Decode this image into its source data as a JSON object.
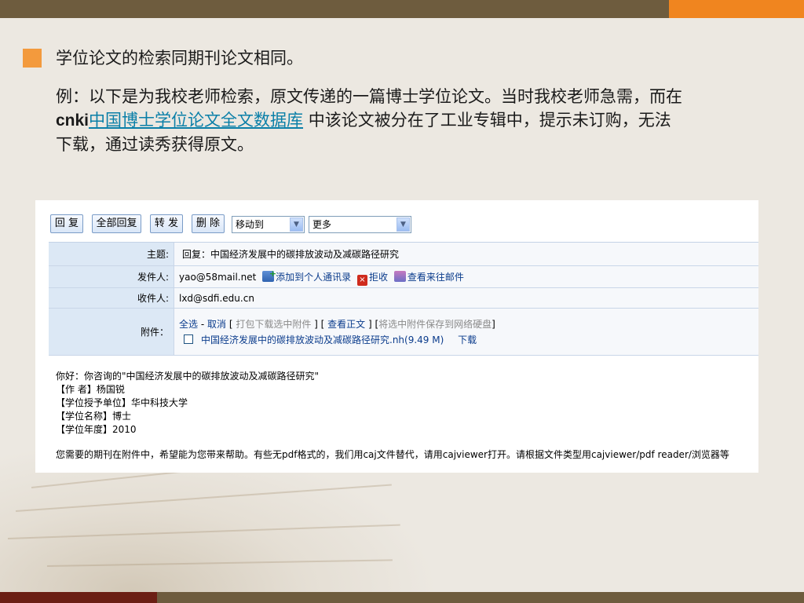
{
  "slide": {
    "bullet": "学位论文的检索同期刊论文相同。",
    "example_part1": "例：以下是为我校老师检索，原文传递的一篇博士学位论文。当时我校老师急需，而在",
    "example_cnki": "cnki",
    "example_link": "中国博士学位论文全文数据库",
    "example_part2": " 中该论文被分在了工业专辑中，提示未订购，无法下载，通过读秀获得原文。"
  },
  "toolbar": {
    "reply": "回 复",
    "reply_all": "全部回复",
    "forward": "转 发",
    "delete": "删 除",
    "move_to": "移动到",
    "more": "更多",
    "dropdown_arrow_icon": "chevron-down-icon"
  },
  "header": {
    "subject_label": "主题:",
    "subject_value": "回复：中国经济发展中的碳排放波动及减碳路径研究",
    "sender_label": "发件人:",
    "sender_value": "yao@58mail.net",
    "add_contact": "添加到个人通讯录",
    "reject": "拒收",
    "view_history": "查看来往邮件",
    "recipient_label": "收件人:",
    "recipient_value": "lxd@sdfi.edu.cn",
    "attach_label": "附件：",
    "select_all": "全选",
    "dash": " - ",
    "cancel": "取消",
    "bracket_open": " [ ",
    "pack_download": "打包下载选中附件",
    "bracket_mid": " ] [ ",
    "view_body": "查看正文",
    "bracket_mid2": " ] [",
    "save_netdisk": "将选中附件保存到网络硬盘",
    "bracket_close": "]",
    "attachment_name": "中国经济发展中的碳排放波动及减碳路径研究.nh(9.49 M)",
    "download": "下载"
  },
  "body": {
    "line1": "你好：你咨询的\"中国经济发展中的碳排放波动及减碳路径研究\"",
    "line2": "【作 者】杨国锐",
    "line3": "【学位授予单位】华中科技大学",
    "line4": "【学位名称】博士",
    "line5": "【学位年度】2010",
    "notice": "您需要的期刊在附件中，希望能为您带来帮助。有些无pdf格式的，我们用caj文件替代，请用cajviewer打开。请根据文件类型用cajviewer/pdf reader/浏览器等"
  },
  "colors": {
    "top_bar": "#6e5c3e",
    "accent_orange": "#f0851f",
    "bullet_orange": "#f39a3d",
    "link_teal": "#0a7fa8",
    "bottom_dark_red": "#6b1f14"
  }
}
